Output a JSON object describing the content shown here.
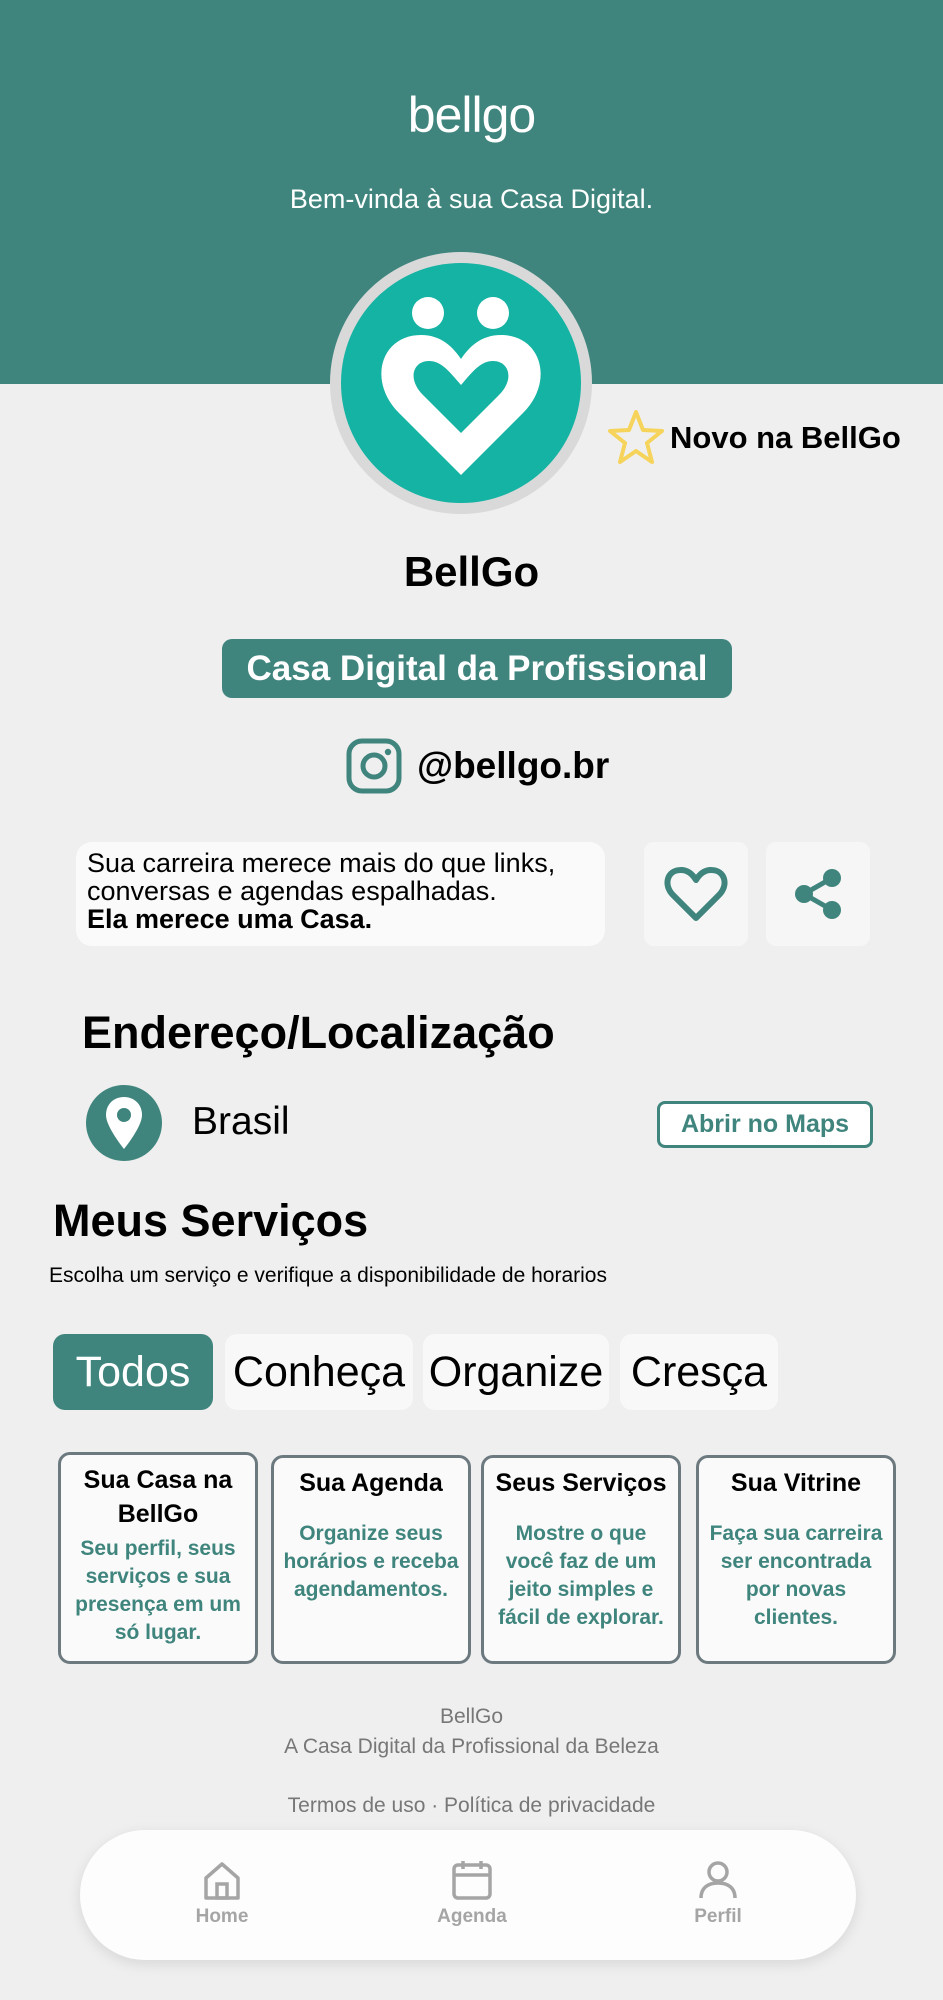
{
  "header": {
    "logo": "bellgo",
    "welcome": "Bem-vinda à sua Casa Digital."
  },
  "profile": {
    "novo_label": "Novo na BellGo",
    "name": "BellGo",
    "badge": "Casa Digital da Profissional",
    "instagram": "@bellgo.br",
    "bio_line1": "Sua carreira merece mais do que links,",
    "bio_line2": "conversas e agendas espalhadas.",
    "bio_bold": "Ela merece uma Casa."
  },
  "location": {
    "title": "Endereço/Localização",
    "place": "Brasil",
    "maps_button": "Abrir no Maps"
  },
  "services": {
    "title": "Meus Serviços",
    "subtitle": "Escolha um serviço e verifique a disponibilidade de horarios",
    "filters": [
      "Todos",
      "Conheça",
      "Organize",
      "Cresça"
    ],
    "active_filter": "Todos",
    "cards": [
      {
        "title1": "Sua Casa na",
        "title2": "BellGo",
        "desc": "Seu perfil, seus serviços e sua presença em um só lugar."
      },
      {
        "title1": "Sua Agenda",
        "title2": "",
        "desc": "Organize seus horários e receba agendamentos."
      },
      {
        "title1": "Seus Serviços",
        "title2": "",
        "desc": "Mostre o que você faz de um jeito simples e fácil de explorar."
      },
      {
        "title1": "Sua Vitrine",
        "title2": "",
        "desc": "Faça sua carreira ser encontrada por novas clientes."
      }
    ]
  },
  "footer": {
    "brand": "BellGo",
    "tagline": "A Casa Digital da Profissional da Beleza",
    "links": "Termos de uso · Política de privacidade"
  },
  "nav": {
    "home": "Home",
    "agenda": "Agenda",
    "perfil": "Perfil"
  },
  "colors": {
    "primary": "#3f857d",
    "avatar": "#15b3a3",
    "star": "#f6d35a",
    "background": "#efefef"
  },
  "icons": [
    "heart-logo-icon",
    "star-icon",
    "instagram-icon",
    "heart-icon",
    "share-icon",
    "location-pin-icon",
    "home-icon",
    "calendar-icon",
    "user-icon"
  ]
}
